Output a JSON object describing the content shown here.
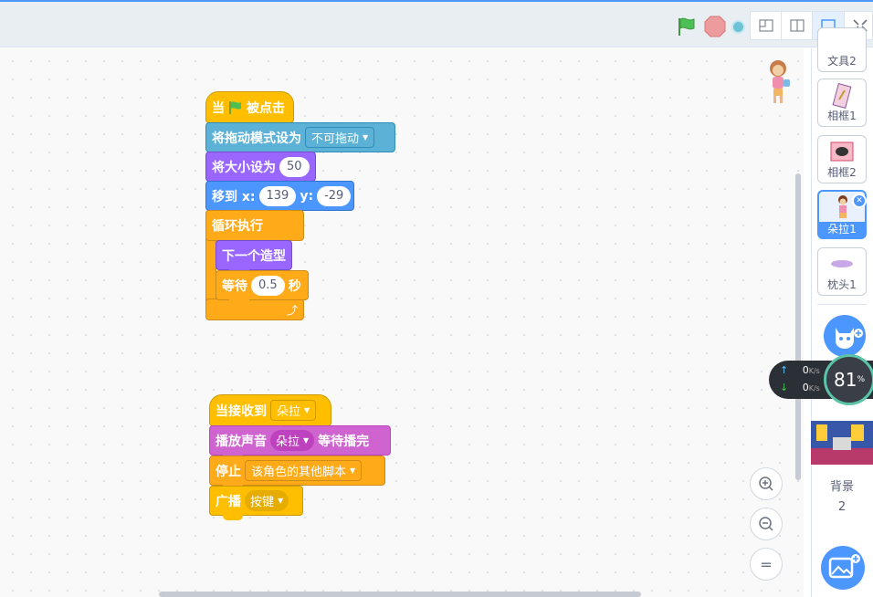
{
  "toolbar": {
    "flag_icon": "green-flag-icon",
    "stop_icon": "stop-sign-icon",
    "layout_buttons": [
      "small-stage-icon",
      "normal-stage-icon",
      "stage-only-icon",
      "fullscreen-icon"
    ]
  },
  "scripts": {
    "script1": {
      "hat": {
        "prefix": "当",
        "suffix": "被点击"
      },
      "drag": {
        "label": "将拖动模式设为",
        "value": "不可拖动"
      },
      "size": {
        "label": "将大小设为",
        "value": "50"
      },
      "goto": {
        "label": "移到 x:",
        "x": "139",
        "y_label": "y:",
        "y": "-29"
      },
      "forever": {
        "label": "循环执行"
      },
      "next": {
        "label": "下一个造型"
      },
      "wait": {
        "label": "等待",
        "value": "0.5",
        "unit": "秒"
      }
    },
    "script2": {
      "hat": {
        "label": "当接收到",
        "value": "朵拉"
      },
      "sound": {
        "label": "播放声音",
        "value": "朵拉",
        "suffix": "等待播完"
      },
      "stop": {
        "label": "停止",
        "value": "该角色的其他脚本"
      },
      "broadcast": {
        "label": "广播",
        "value": "按键"
      }
    }
  },
  "zoom": {
    "in": "+",
    "out": "−",
    "reset": "="
  },
  "sprites": [
    {
      "label": "文具2"
    },
    {
      "label": "相框1"
    },
    {
      "label": "相框2"
    },
    {
      "label": "朵拉1",
      "selected": true
    },
    {
      "label": "枕头1"
    }
  ],
  "network": {
    "up": "0",
    "down": "0",
    "unit": "K/s",
    "percent": "81",
    "percent_sign": "%"
  },
  "stage_panel": {
    "label": "背景",
    "count": "2"
  }
}
